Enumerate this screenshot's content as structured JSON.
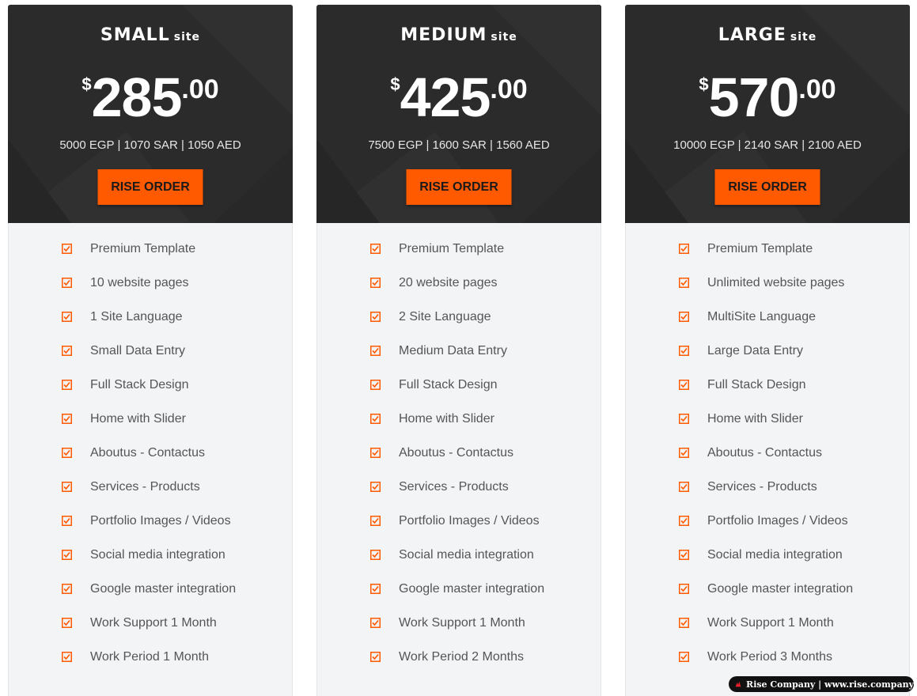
{
  "plans": [
    {
      "title": "SMALL",
      "title_suffix": "site",
      "currency": "$",
      "amount": "285",
      "cents": ".00",
      "local_prices": "5000 EGP | 1070 SAR | 1050 AED",
      "order_label": "RISE ORDER",
      "features": [
        "Premium Template",
        "10 website pages",
        "1 Site Language",
        "Small Data Entry",
        "Full Stack Design",
        "Home with Slider",
        "Aboutus - Contactus",
        "Services - Products",
        "Portfolio Images / Videos",
        "Social media integration",
        "Google master integration",
        "Work Support 1 Month",
        "Work Period 1 Month"
      ]
    },
    {
      "title": "MEDIUM",
      "title_suffix": "site",
      "currency": "$",
      "amount": "425",
      "cents": ".00",
      "local_prices": "7500 EGP | 1600 SAR | 1560 AED",
      "order_label": "RISE ORDER",
      "features": [
        "Premium Template",
        "20 website pages",
        "2 Site Language",
        "Medium Data Entry",
        "Full Stack Design",
        "Home with Slider",
        "Aboutus - Contactus",
        "Services - Products",
        "Portfolio Images / Videos",
        "Social media integration",
        "Google master integration",
        "Work Support 1 Month",
        "Work Period 2 Months"
      ]
    },
    {
      "title": "LARGE",
      "title_suffix": "site",
      "currency": "$",
      "amount": "570",
      "cents": ".00",
      "local_prices": "10000 EGP | 2140 SAR | 2100 AED",
      "order_label": "RISE ORDER",
      "features": [
        "Premium Template",
        "Unlimited website pages",
        "MultiSite Language",
        "Large Data Entry",
        "Full Stack Design",
        "Home with Slider",
        "Aboutus - Contactus",
        "Services - Products",
        "Portfolio Images / Videos",
        "Social media integration",
        "Google master integration",
        "Work Support 1 Month",
        "Work Period 3 Months"
      ]
    }
  ],
  "watermark": {
    "text": "Rise Company | www.rise.company",
    "icon": "rise-logo-icon"
  },
  "colors": {
    "header_bg": "#2b2b2b",
    "accent": "#ff5a00",
    "body_bg": "#f3f4f6",
    "feature_text": "#555555"
  },
  "icons": {
    "feature": "checkbox-checked-icon"
  }
}
